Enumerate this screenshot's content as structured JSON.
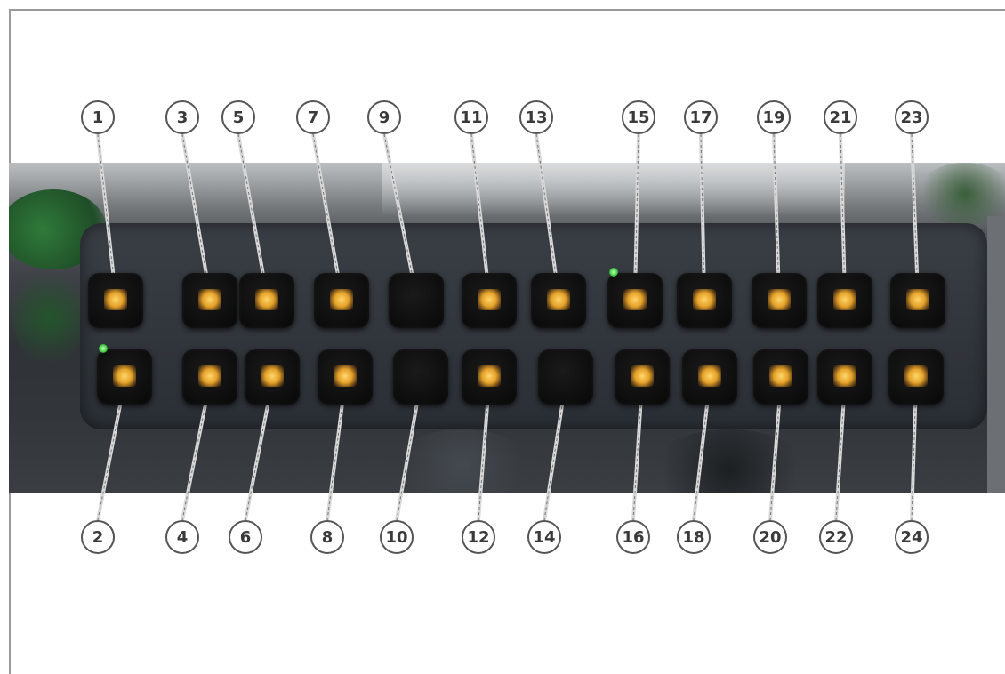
{
  "callouts_top": [
    "1",
    "3",
    "5",
    "7",
    "9",
    "11",
    "13",
    "15",
    "17",
    "19",
    "21",
    "23"
  ],
  "callouts_bottom": [
    "2",
    "4",
    "6",
    "8",
    "10",
    "12",
    "14",
    "16",
    "18",
    "20",
    "22",
    "24"
  ],
  "buttons_top": [
    {
      "icon": "fan-speed-icon",
      "lit": true
    },
    {
      "icon": "rear-defrost-icon",
      "lit": true
    },
    {
      "icon": "work-light-icon",
      "lit": true
    },
    {
      "icon": "beacon-icon",
      "lit": true
    },
    {
      "icon": "blank-icon",
      "lit": false
    },
    {
      "icon": "trailer-icon",
      "lit": true
    },
    {
      "icon": "lock-icon",
      "lit": true
    },
    {
      "icon": "wiper-icon",
      "lit": true
    },
    {
      "icon": "loader-icon",
      "lit": true
    },
    {
      "icon": "implement-icon",
      "lit": true
    },
    {
      "icon": "tipper-icon",
      "lit": true
    },
    {
      "icon": "boom-icon",
      "lit": true
    }
  ],
  "buttons_bottom": [
    {
      "icon": "hazard-icon",
      "lit": true
    },
    {
      "icon": "front-defrost-icon",
      "lit": true
    },
    {
      "icon": "side-light-icon",
      "lit": true
    },
    {
      "icon": "horn-icon",
      "lit": true
    },
    {
      "icon": "blank-icon",
      "lit": false
    },
    {
      "icon": "gauge-icon",
      "lit": true
    },
    {
      "icon": "blank-icon",
      "lit": false
    },
    {
      "icon": "pump-icon",
      "lit": true
    },
    {
      "icon": "attachment-icon",
      "lit": true
    },
    {
      "icon": "bucket-icon",
      "lit": true
    },
    {
      "icon": "hitch-icon",
      "lit": true
    },
    {
      "icon": "dump-icon",
      "lit": true
    }
  ],
  "indicator_color": "#40d040",
  "symbol_color": "#f0b040"
}
